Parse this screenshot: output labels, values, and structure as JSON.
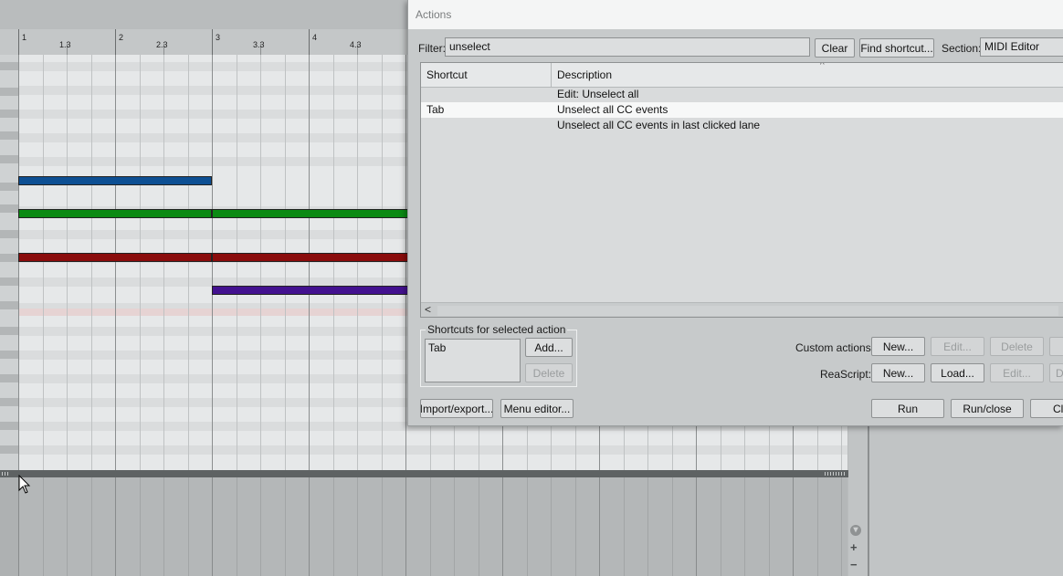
{
  "ruler": {
    "labels": [
      "1",
      "1.3",
      "2",
      "2.3",
      "3",
      "3.3",
      "4",
      "4.3"
    ]
  },
  "notes": [
    {
      "name": "blue",
      "color": "#0d4f93"
    },
    {
      "name": "green",
      "color": "#0b8a13"
    },
    {
      "name": "red",
      "color": "#8a0c0c"
    },
    {
      "name": "purple",
      "color": "#43118f"
    }
  ],
  "actions_dialog": {
    "title": "Actions",
    "filter_label": "Filter:",
    "filter_value": "unselect",
    "clear_button": "Clear",
    "find_shortcut_button": "Find shortcut...",
    "section_label": "Section:",
    "section_value": "MIDI Editor",
    "list": {
      "columns": [
        "Shortcut",
        "Description"
      ],
      "rows": [
        {
          "shortcut": "",
          "description": "Edit: Unselect all"
        },
        {
          "shortcut": "Tab",
          "description": "Unselect all CC events"
        },
        {
          "shortcut": "",
          "description": "Unselect all CC events in last clicked lane"
        }
      ],
      "scroll_left_glyph": "<"
    },
    "shortcuts_group": {
      "title": "Shortcuts for selected action",
      "items": [
        "Tab"
      ],
      "add_button": "Add...",
      "delete_button": "Delete"
    },
    "custom_actions": {
      "label": "Custom actions:",
      "new_button": "New...",
      "edit_button": "Edit...",
      "delete_button": "Delete"
    },
    "reascript": {
      "label": "ReaScript:",
      "new_button": "New...",
      "load_button": "Load...",
      "edit_button": "Edit...",
      "partial_button": "D"
    },
    "bottom": {
      "import_export_button": "Import/export...",
      "menu_editor_button": "Menu editor...",
      "run_button": "Run",
      "run_close_button": "Run/close",
      "close_button": "Cl"
    }
  },
  "zoom_controls": {
    "down": "▾",
    "plus": "+",
    "minus": "−"
  }
}
